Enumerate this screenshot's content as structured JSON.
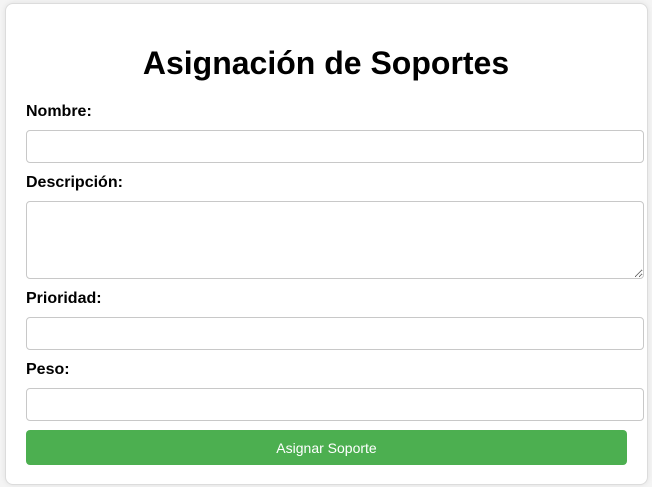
{
  "form": {
    "title": "Asignación de Soportes",
    "fields": [
      {
        "label": "Nombre:",
        "value": "",
        "placeholder": ""
      },
      {
        "label": "Descripción:",
        "value": "",
        "placeholder": ""
      },
      {
        "label": "Prioridad:",
        "value": "",
        "placeholder": ""
      },
      {
        "label": "Peso:",
        "value": "",
        "placeholder": ""
      }
    ],
    "submit_label": "Asignar Soporte"
  },
  "colors": {
    "accent": "#4caf50",
    "background": "#f4f4f4",
    "card": "#ffffff",
    "border": "#c8c8c8"
  }
}
